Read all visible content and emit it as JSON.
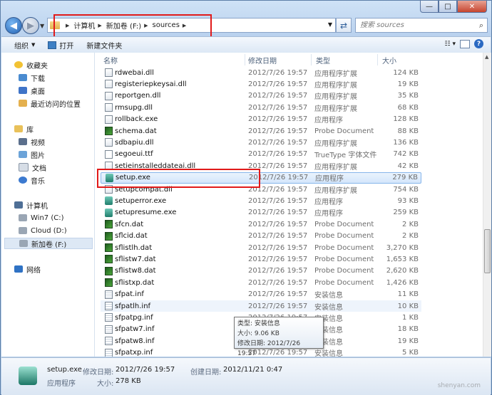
{
  "window": {
    "min": "—",
    "max": "□",
    "close": "✕"
  },
  "address": {
    "crumbs": [
      "计算机",
      "新加卷 (F:)",
      "sources"
    ],
    "search_placeholder": "搜索 sources"
  },
  "toolbar": {
    "organize": "组织",
    "open": "打开",
    "new_folder": "新建文件夹",
    "help": "?"
  },
  "nav": {
    "favorites": "收藏夹",
    "downloads": "下载",
    "desktop": "桌面",
    "recent": "最近访问的位置",
    "libraries": "库",
    "videos": "视频",
    "pictures": "图片",
    "documents": "文档",
    "music": "音乐",
    "computer": "计算机",
    "drive_c": "Win7 (C:)",
    "drive_d": "Cloud (D:)",
    "drive_f": "新加卷 (F:)",
    "network": "网络"
  },
  "columns": {
    "name": "名称",
    "date": "修改日期",
    "type": "类型",
    "size": "大小"
  },
  "files": [
    {
      "name": "rdwebai.dll",
      "date": "2012/7/26 19:57",
      "type": "应用程序扩展",
      "size": "124 KB",
      "kind": "dll"
    },
    {
      "name": "registeriepkeysai.dll",
      "date": "2012/7/26 19:57",
      "type": "应用程序扩展",
      "size": "19 KB",
      "kind": "dll"
    },
    {
      "name": "reportgen.dll",
      "date": "2012/7/26 19:57",
      "type": "应用程序扩展",
      "size": "35 KB",
      "kind": "dll"
    },
    {
      "name": "rmsupg.dll",
      "date": "2012/7/26 19:57",
      "type": "应用程序扩展",
      "size": "68 KB",
      "kind": "dll"
    },
    {
      "name": "rollback.exe",
      "date": "2012/7/26 19:57",
      "type": "应用程序",
      "size": "128 KB",
      "kind": "dll"
    },
    {
      "name": "schema.dat",
      "date": "2012/7/26 19:57",
      "type": "Probe Document",
      "size": "88 KB",
      "kind": "dat"
    },
    {
      "name": "sdbapiu.dll",
      "date": "2012/7/26 19:57",
      "type": "应用程序扩展",
      "size": "136 KB",
      "kind": "dll"
    },
    {
      "name": "segoeui.ttf",
      "date": "2012/7/26 19:57",
      "type": "TrueType 字体文件",
      "size": "742 KB",
      "kind": "ttf"
    },
    {
      "name": "setieinstalleddateai.dll",
      "date": "2012/7/26 19:57",
      "type": "应用程序扩展",
      "size": "42 KB",
      "kind": "dll"
    },
    {
      "name": "setup.exe",
      "date": "2012/7/26 19:57",
      "type": "应用程序",
      "size": "279 KB",
      "kind": "exe",
      "selected": true
    },
    {
      "name": "setupcompat.dll",
      "date": "2012/7/26 19:57",
      "type": "应用程序扩展",
      "size": "754 KB",
      "kind": "dll"
    },
    {
      "name": "setuperror.exe",
      "date": "2012/7/26 19:57",
      "type": "应用程序",
      "size": "93 KB",
      "kind": "exe"
    },
    {
      "name": "setupresume.exe",
      "date": "2012/7/26 19:57",
      "type": "应用程序",
      "size": "259 KB",
      "kind": "exe"
    },
    {
      "name": "sfcn.dat",
      "date": "2012/7/26 19:57",
      "type": "Probe Document",
      "size": "2 KB",
      "kind": "dat"
    },
    {
      "name": "sflcid.dat",
      "date": "2012/7/26 19:57",
      "type": "Probe Document",
      "size": "2 KB",
      "kind": "dat"
    },
    {
      "name": "sflistlh.dat",
      "date": "2012/7/26 19:57",
      "type": "Probe Document",
      "size": "3,270 KB",
      "kind": "dat"
    },
    {
      "name": "sflistw7.dat",
      "date": "2012/7/26 19:57",
      "type": "Probe Document",
      "size": "1,653 KB",
      "kind": "dat"
    },
    {
      "name": "sflistw8.dat",
      "date": "2012/7/26 19:57",
      "type": "Probe Document",
      "size": "2,620 KB",
      "kind": "dat"
    },
    {
      "name": "sflistxp.dat",
      "date": "2012/7/26 19:57",
      "type": "Probe Document",
      "size": "1,426 KB",
      "kind": "dat"
    },
    {
      "name": "sfpat.inf",
      "date": "2012/7/26 19:57",
      "type": "安装信息",
      "size": "11 KB",
      "kind": "inf"
    },
    {
      "name": "sfpatlh.inf",
      "date": "2012/7/26 19:57",
      "type": "安装信息",
      "size": "10 KB",
      "kind": "inf",
      "hover": true
    },
    {
      "name": "sfpatpg.inf",
      "date": "2012/7/26 19:57",
      "type": "安装信息",
      "size": "1 KB",
      "kind": "inf"
    },
    {
      "name": "sfpatw7.inf",
      "date": "2012/7/26 19:57",
      "type": "安装信息",
      "size": "18 KB",
      "kind": "inf"
    },
    {
      "name": "sfpatw8.inf",
      "date": "2012/7/26 19:57",
      "type": "安装信息",
      "size": "19 KB",
      "kind": "inf"
    },
    {
      "name": "sfpatxp.inf",
      "date": "2012/7/26 19:57",
      "type": "安装信息",
      "size": "5 KB",
      "kind": "inf"
    }
  ],
  "tooltip": {
    "type": "类型: 安装信息",
    "size": "大小: 9.06 KB",
    "modified": "修改日期: 2012/7/26 19:57"
  },
  "details": {
    "name": "setup.exe",
    "modified_label": "修改日期:",
    "modified": "2012/7/26 19:57",
    "created_label": "创建日期:",
    "created": "2012/11/21 0:47",
    "type": "应用程序",
    "size_label": "大小:",
    "size": "278 KB"
  },
  "watermark": "shenyan.com"
}
